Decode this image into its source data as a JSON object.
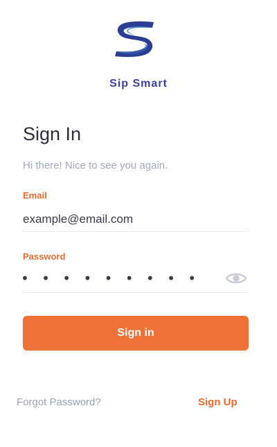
{
  "app": {
    "brand_name": "Sip Smart",
    "logo_icon": "s-logo-icon"
  },
  "signin": {
    "title": "Sign In",
    "subtitle": "Hi there! Nice to see you again.",
    "email": {
      "label": "Email",
      "value": "example@email.com"
    },
    "password": {
      "label": "Password",
      "masked_value": "• • • • • • • • • • •",
      "toggle_icon": "eye-icon"
    },
    "submit_label": "Sign in",
    "forgot_label": "Forgot Password?",
    "signup_label": "Sign Up"
  },
  "colors": {
    "accent": "#ee7138",
    "brand": "#3a3fa0",
    "muted": "#a3a8bc"
  }
}
